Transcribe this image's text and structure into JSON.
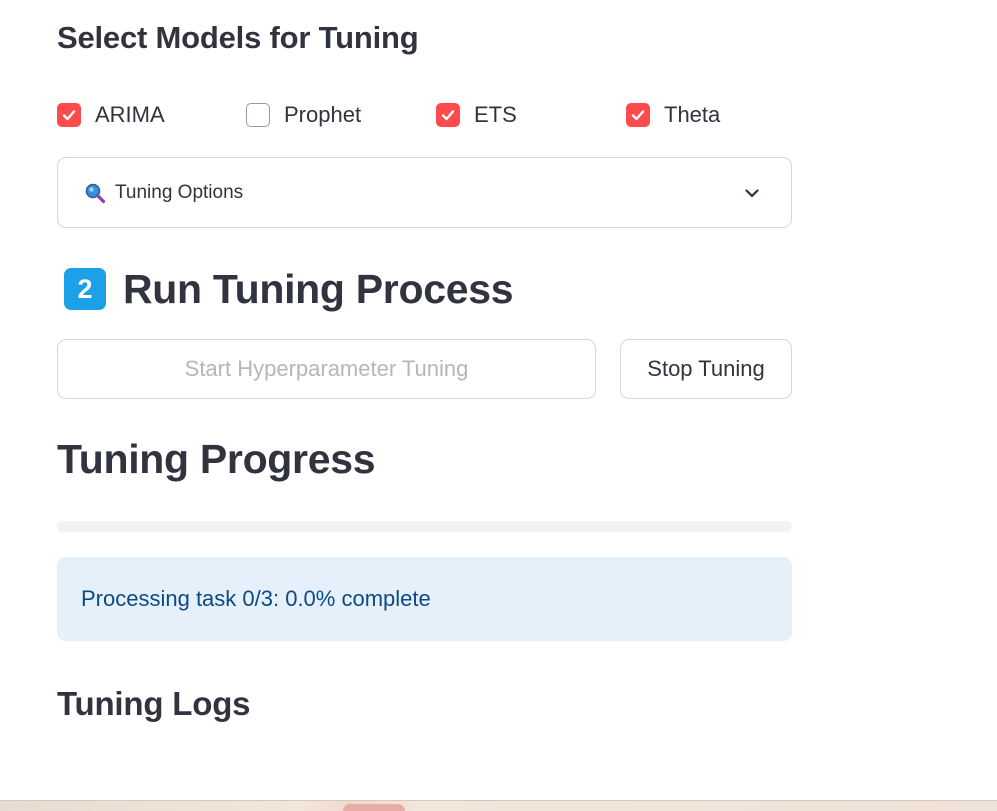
{
  "models_section": {
    "title": "Select Models for Tuning",
    "models": [
      {
        "label": "ARIMA",
        "checked": true
      },
      {
        "label": "Prophet",
        "checked": false
      },
      {
        "label": "ETS",
        "checked": true
      },
      {
        "label": "Theta",
        "checked": true
      }
    ]
  },
  "tuning_options": {
    "label": "Tuning Options",
    "icon": "magnifying-glass-icon",
    "expanded": false
  },
  "run_section": {
    "badge": "2",
    "title": "Run Tuning Process",
    "start_button": "Start Hyperparameter Tuning",
    "start_disabled": true,
    "stop_button": "Stop Tuning"
  },
  "progress_section": {
    "title": "Tuning Progress",
    "progress_fraction": 0.0,
    "status_text": "Processing task 0/3: 0.0% complete"
  },
  "logs_section": {
    "title": "Tuning Logs"
  },
  "colors": {
    "accent": "#ff4b4b",
    "badge": "#1ca0e8",
    "info_bg": "#e6f0fa",
    "info_text": "#0b4a85",
    "text": "#31333f"
  }
}
